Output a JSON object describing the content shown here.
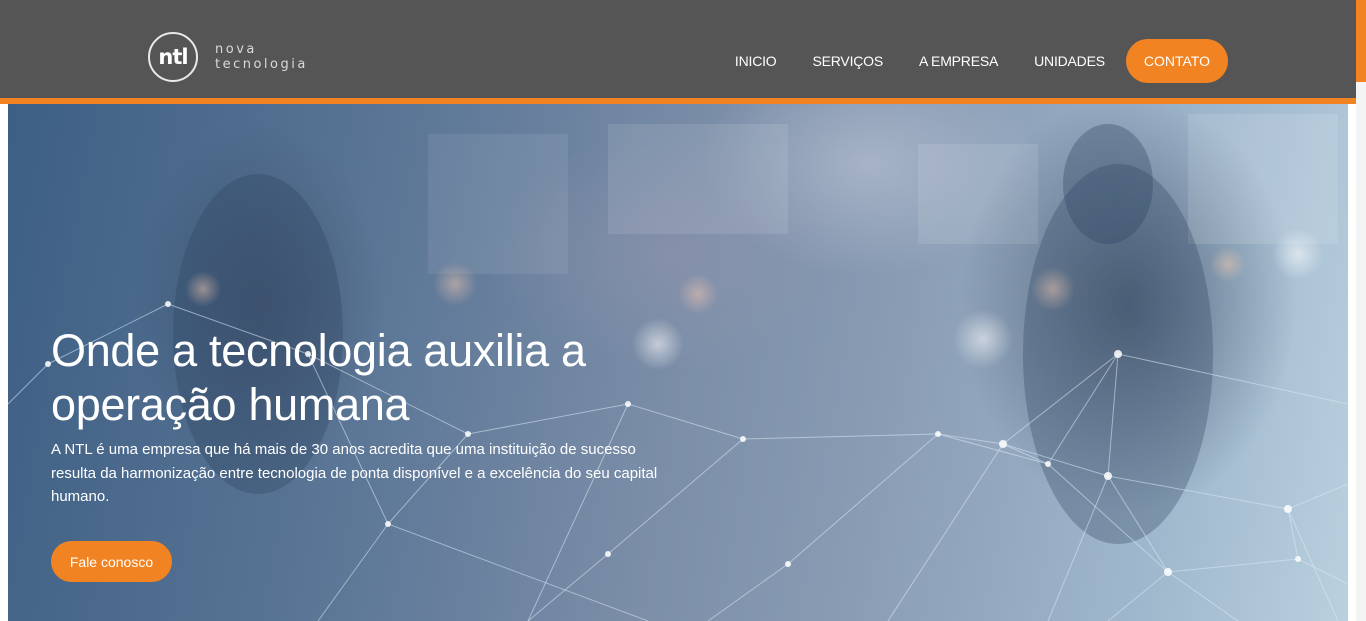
{
  "brand": {
    "logo_mark": "ntl",
    "name_line1": "nova",
    "name_line2": "tecnologia"
  },
  "colors": {
    "accent": "#f28322",
    "header_bg": "#555555"
  },
  "nav": {
    "items": [
      {
        "label": "INICIO"
      },
      {
        "label": "SERVIÇOS"
      },
      {
        "label": "A EMPRESA"
      },
      {
        "label": "UNIDADES"
      }
    ],
    "contact_label": "CONTATO"
  },
  "hero": {
    "title_line1": "Onde a tecnologia auxilia a",
    "title_line2": "operação humana",
    "description": "A NTL é uma empresa que há mais de 30 anos acredita que uma instituição de sucesso resulta da harmonização entre tecnologia de ponta disponível e a excelência do seu capital humano.",
    "cta_label": "Fale conosco"
  }
}
